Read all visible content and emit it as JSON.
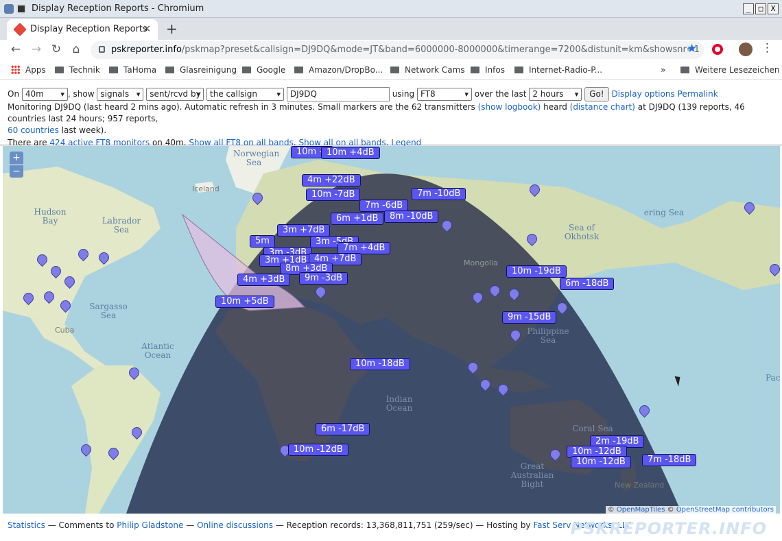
{
  "window": {
    "title": "Display Reception Reports - Chromium",
    "min": "_",
    "max": "□",
    "close": "X"
  },
  "tab": {
    "title": "Display Reception Reports",
    "close": "×",
    "new": "+"
  },
  "omnibox": {
    "host": "pskreporter.info",
    "path": "/pskmap?preset&callsign=DJ9DQ&mode=JT&band=6000000-8000000&timerange=7200&distunit=km&showsnr=1"
  },
  "bookmarks": {
    "items": [
      "Apps",
      "Technik",
      "TaHoma",
      "Glasreinigung",
      "Google",
      "Amazon/DropBo...",
      "Network Cams",
      "Infos",
      "Internet-Radio-P..."
    ],
    "more": "»",
    "other": "Weitere Lesezeichen"
  },
  "controls": {
    "on_label": "On",
    "band": "40m",
    "show_label": ", show",
    "show": "signals",
    "direction": "sent/rcvd by",
    "target": "the callsign",
    "callsign": "DJ9DQ",
    "using_label": "using",
    "mode": "FT8",
    "over_label": "over the last",
    "range": "2 hours",
    "go": "Go!",
    "display_options": "Display options",
    "permalink": "Permalink"
  },
  "info": {
    "l1a": "Monitoring DJ9DQ (last heard 2 mins ago). Automatic refresh in 3 minutes. Small markers are the 62 transmitters",
    "show_logbook": "(show logbook)",
    "heard": "heard",
    "distance_chart": "(distance chart)",
    "l1b": "at DJ9DQ (139 reports, 46 countries last 24 hours; 957 reports,",
    "countries": "60 countries",
    "l2b": "last week).",
    "l3a": "There are",
    "monitors": "424 active FT8 monitors",
    "l3b": "on 40m.",
    "show_all_ft8": "Show all FT8 on all bands",
    "show_all": "Show all on all bands",
    "legend": "Legend"
  },
  "map": {
    "zoom_in": "+",
    "zoom_out": "−",
    "labels": {
      "norwegian": "Norwegian Sea",
      "iceland": "Iceland",
      "hudson": "Hudson Bay",
      "labrador": "Labrador Sea",
      "sargasso": "Sargasso Sea",
      "atlantic": "Atlantic Ocean",
      "cuba": "Cuba",
      "mongolia": "Mongolia",
      "okhotsk": "Sea of Okhotsk",
      "bering": "ering Sea",
      "philippine": "Philippine Sea",
      "indian": "Indian Ocean",
      "coral": "Coral Sea",
      "australia": "Great Australian Bight",
      "nz": "New Zealand",
      "pac": "Pac"
    },
    "spots": [
      "10m -5",
      "10m +4dB",
      "4m +22dB",
      "10m -7dB",
      "7m -10dB",
      "7m -6dB",
      "6m +1dB",
      "8m -10dB",
      "3m +7dB",
      "5m",
      "3m -5dB",
      "7m +4dB",
      "3m -3dB",
      "3m +1dB",
      "4m +7dB",
      "8m +3dB",
      "4m +3dB",
      "9m -3dB",
      "10m +5dB",
      "10m -19dB",
      "6m -18dB",
      "9m -15dB",
      "10m -18dB",
      "6m -17dB",
      "10m -12dB",
      "2m -19dB",
      "10m -12dB",
      "10m -12dB",
      "7m -18dB"
    ],
    "attribution_pre": "©",
    "osm_tiles": "OpenMapTiles",
    "osm": "OpenStreetMap contributors"
  },
  "footer": {
    "statistics": "Statistics",
    "comments": "— Comments to",
    "author": "Philip Gladstone",
    "dash1": "—",
    "discussions": "Online discussions",
    "records": "— Reception records: 13,368,811,751 (259/sec) — Hosting by",
    "hosting": "Fast Serv Networks, LLC",
    "brand": "PSKREPORTER.INFO"
  }
}
